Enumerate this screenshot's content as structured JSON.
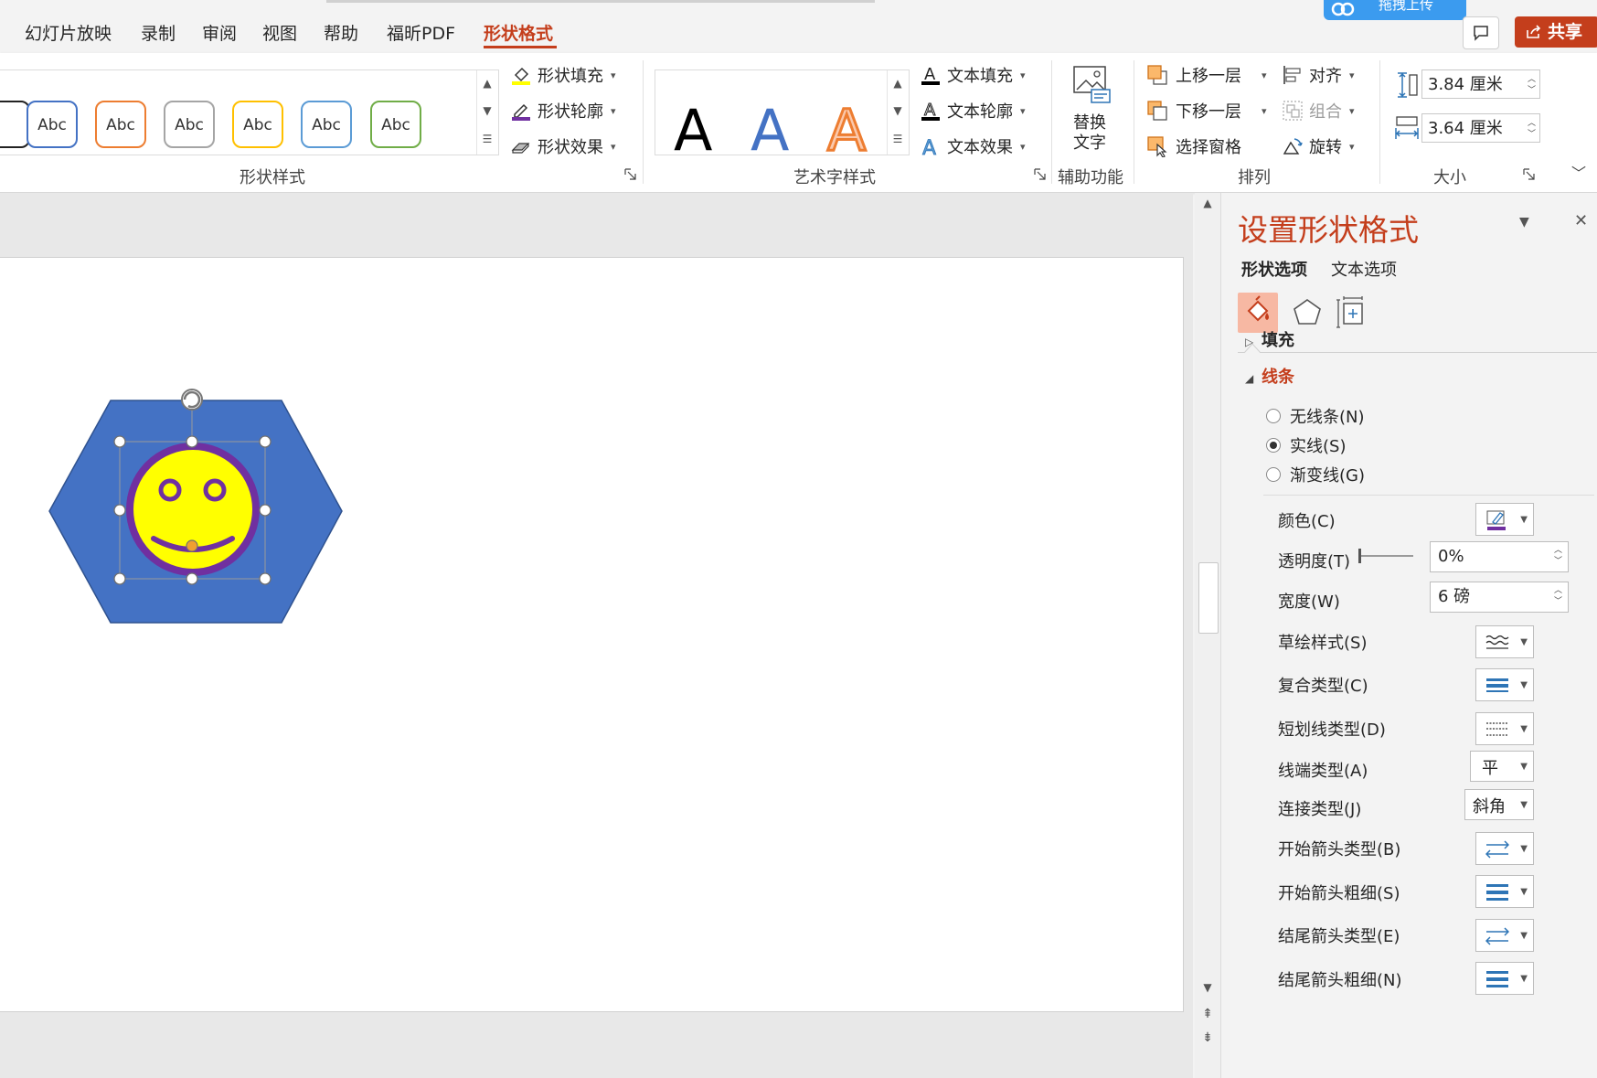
{
  "tabs": [
    {
      "label": "幻灯片放映",
      "active": false
    },
    {
      "label": "录制",
      "active": false
    },
    {
      "label": "审阅",
      "active": false
    },
    {
      "label": "视图",
      "active": false
    },
    {
      "label": "帮助",
      "active": false
    },
    {
      "label": "福昕PDF",
      "active": false
    },
    {
      "label": "形状格式",
      "active": true
    }
  ],
  "top_right": {
    "upload_label": "拖拽上传",
    "share_label": "共享"
  },
  "ribbon": {
    "shape_styles": {
      "gallery_items": [
        "Abc",
        "Abc",
        "Abc",
        "Abc",
        "Abc",
        "Abc"
      ],
      "gallery_colors": [
        "#4472c4",
        "#ed7d31",
        "#a5a5a5",
        "#ffc000",
        "#5b9bd5",
        "#70ad47"
      ],
      "fill_label": "形状填充",
      "outline_label": "形状轮廓",
      "effect_label": "形状效果",
      "group_label": "形状样式"
    },
    "wordart_styles": {
      "letters": [
        "A",
        "A",
        "A"
      ],
      "text_fill_label": "文本填充",
      "text_outline_label": "文本轮廓",
      "text_effect_label": "文本效果",
      "group_label": "艺术字样式"
    },
    "accessibility": {
      "alt_text_line1": "替换",
      "alt_text_line2": "文字",
      "group_label": "辅助功能"
    },
    "arrange": {
      "bring_forward": "上移一层",
      "send_backward": "下移一层",
      "selection_pane": "选择窗格",
      "align": "对齐",
      "group": "组合",
      "rotate": "旋转",
      "group_label": "排列"
    },
    "size": {
      "height": "3.84 厘米",
      "width": "3.64 厘米",
      "group_label": "大小"
    }
  },
  "pane": {
    "title": "设置形状格式",
    "tabs": [
      "形状选项",
      "文本选项"
    ],
    "sections": {
      "fill": "填充",
      "line": "线条"
    },
    "line_options": [
      {
        "label": "无线条(N)",
        "selected": false
      },
      {
        "label": "实线(S)",
        "selected": true
      },
      {
        "label": "渐变线(G)",
        "selected": false
      }
    ],
    "props": {
      "color": "颜色(C)",
      "transparency": "透明度(T)",
      "transparency_value": "0%",
      "width": "宽度(W)",
      "width_value": "6 磅",
      "sketch": "草绘样式(S)",
      "compound": "复合类型(C)",
      "dash": "短划线类型(D)",
      "cap": "线端类型(A)",
      "cap_value": "平",
      "join": "连接类型(J)",
      "join_value": "斜角",
      "begin_arrow_type": "开始箭头类型(B)",
      "begin_arrow_size": "开始箭头粗细(S)",
      "end_arrow_type": "结尾箭头类型(E)",
      "end_arrow_size": "结尾箭头粗细(N)"
    }
  },
  "colors": {
    "accent": "#c43e1c",
    "hexagon": "#4472c4",
    "smiley": "#ffff00",
    "smiley_outline": "#7030a0",
    "line_color": "#7030a0"
  }
}
